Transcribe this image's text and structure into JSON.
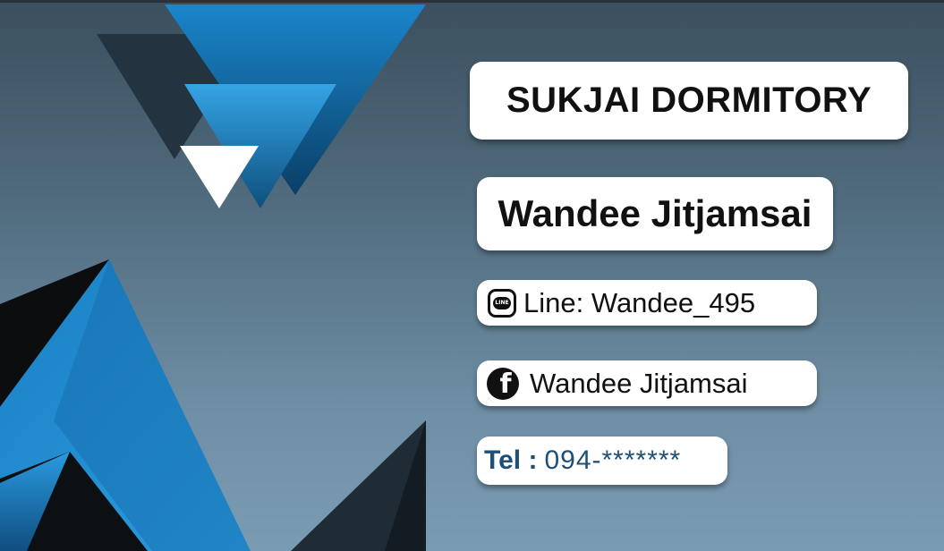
{
  "card": {
    "title": "SUKJAI DORMITORY",
    "name": "Wandee Jitjamsai",
    "line_text": "Line: Wandee_495",
    "line_badge": "LINE",
    "facebook_text": "Wandee Jitjamsai",
    "tel_label": "Tel :",
    "tel_number": "094-*******"
  },
  "icons": [
    "line-icon",
    "facebook-icon"
  ],
  "colors": {
    "accent_blue": "#1b83c9",
    "tel_text": "#1e5077",
    "dark_shape": "#1f2b35"
  }
}
